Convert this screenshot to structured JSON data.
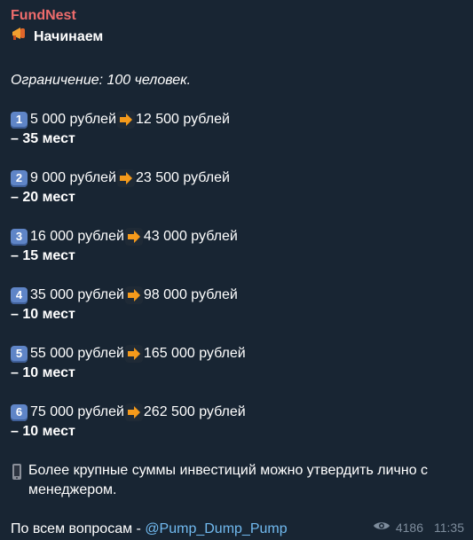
{
  "message": {
    "sender": "FundNest",
    "title": "Начинаем",
    "limit": "Ограничение: 100 человек.",
    "tiers": [
      {
        "num": "1",
        "from": "5 000 рублей",
        "to": "12 500 рублей",
        "places": "– 35 мест"
      },
      {
        "num": "2",
        "from": "9 000 рублей",
        "to": "23 500 рублей",
        "places": "– 20 мест"
      },
      {
        "num": "3",
        "from": "16 000 рублей",
        "to": "43 000 рублей",
        "places": "– 15 мест"
      },
      {
        "num": "4",
        "from": "35 000 рублей",
        "to": "98 000 рублей",
        "places": "– 10 мест"
      },
      {
        "num": "5",
        "from": "55 000 рублей",
        "to": "165 000 рублей",
        "places": "– 10 мест"
      },
      {
        "num": "6",
        "from": "75 000 рублей",
        "to": "262 500 рублей",
        "places": "– 10 мест"
      }
    ],
    "note": "Более крупные суммы инвестиций можно утвердить лично с менеджером.",
    "contact_prefix": "По всем вопросам - ",
    "contact_handle": "@Pump_Dump_Pump",
    "views": "4186",
    "time": "11:35"
  },
  "colors": {
    "sender": "#ee6c6c",
    "link": "#71baf0",
    "meta": "#7e8d9d",
    "background": "#182533"
  },
  "icons": {
    "title": "megaphone-icon",
    "arrow": "right-arrow-icon",
    "note": "phone-icon",
    "views": "eye-icon"
  }
}
